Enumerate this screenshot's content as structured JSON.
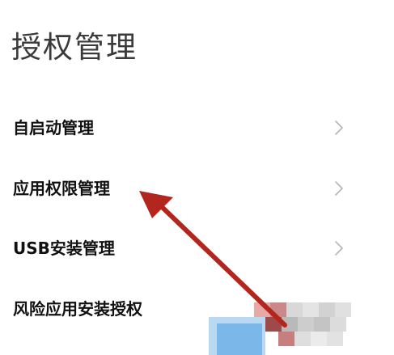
{
  "header": {
    "title": "授权管理"
  },
  "menu": {
    "items": [
      {
        "label": "自启动管理",
        "has_chevron": true
      },
      {
        "label": "应用权限管理",
        "has_chevron": true
      },
      {
        "label": "USB安装管理",
        "has_chevron": true
      },
      {
        "label": "风险应用安装授权",
        "has_chevron": false
      }
    ]
  },
  "icons": {
    "chevron": "chevron-right-icon"
  },
  "colors": {
    "background": "#ffffff",
    "title_text": "#3a3a3a",
    "item_text": "#111111",
    "chevron": "#b5b5b5",
    "annotation_arrow": "#b3261e"
  }
}
